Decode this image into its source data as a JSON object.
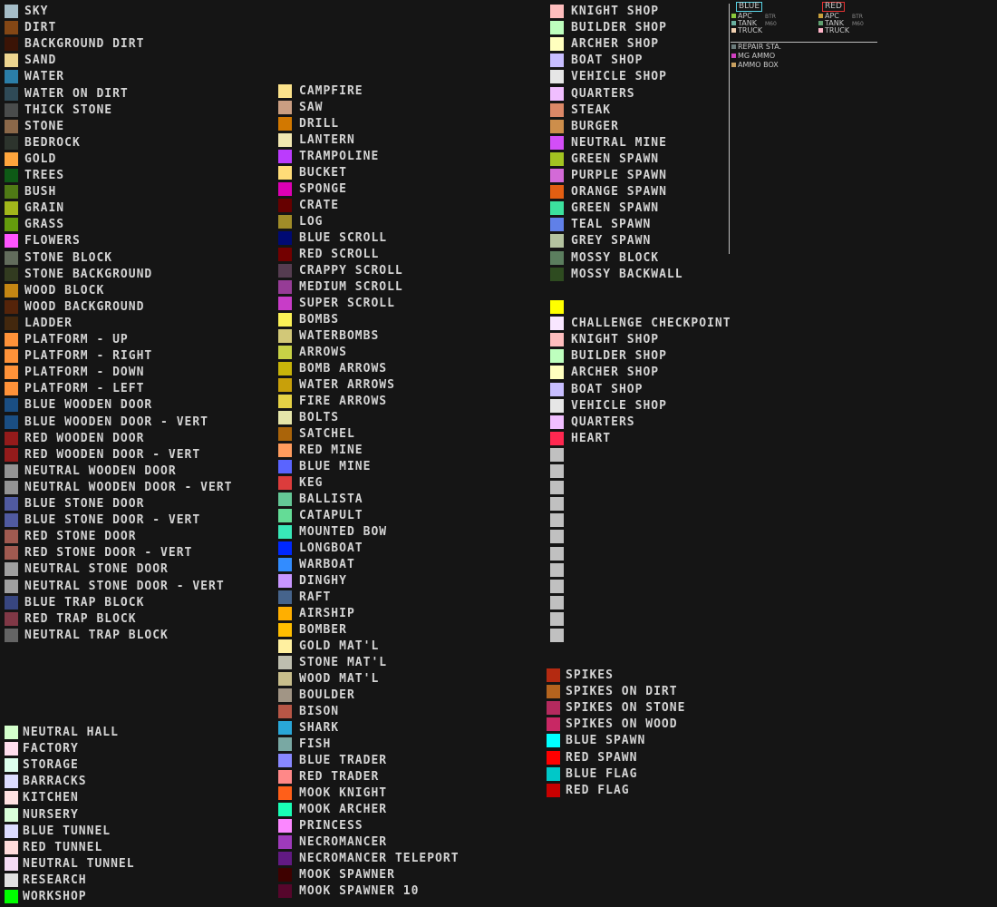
{
  "columns": [
    {
      "items": [
        {
          "label": "SKY",
          "color": "#a5bdc8"
        },
        {
          "label": "DIRT",
          "color": "#844715"
        },
        {
          "label": "BACKGROUND DIRT",
          "color": "#3b1406"
        },
        {
          "label": "SAND",
          "color": "#ecd590"
        },
        {
          "label": "WATER",
          "color": "#2b7ea8"
        },
        {
          "label": "WATER ON DIRT",
          "color": "#2f4a57"
        },
        {
          "label": "THICK STONE",
          "color": "#4a4c4c"
        },
        {
          "label": "STONE",
          "color": "#8b6849"
        },
        {
          "label": "BEDROCK",
          "color": "#2d342d"
        },
        {
          "label": "GOLD",
          "color": "#fea53d"
        },
        {
          "label": "TREES",
          "color": "#0e5a16"
        },
        {
          "label": "BUSH",
          "color": "#4f7a15"
        },
        {
          "label": "GRAIN",
          "color": "#a2b71b"
        },
        {
          "label": "GRASS",
          "color": "#649b0d"
        },
        {
          "label": "FLOWERS",
          "color": "#ff55ff"
        },
        {
          "label": "STONE BLOCK",
          "color": "#626c5c"
        },
        {
          "label": "STONE BACKGROUND",
          "color": "#323b20"
        },
        {
          "label": "WOOD BLOCK",
          "color": "#c48613"
        },
        {
          "label": "WOOD BACKGROUND",
          "color": "#55240a"
        },
        {
          "label": "LADDER",
          "color": "#43280e"
        },
        {
          "label": "PLATFORM - UP",
          "color": "#ff9239"
        },
        {
          "label": "PLATFORM - RIGHT",
          "color": "#ff9239"
        },
        {
          "label": "PLATFORM - DOWN",
          "color": "#ff9239"
        },
        {
          "label": "PLATFORM - LEFT",
          "color": "#ff9239"
        },
        {
          "label": "BLUE WOODEN DOOR",
          "color": "#1a4e83"
        },
        {
          "label": "BLUE WOODEN DOOR - VERT",
          "color": "#1a4e83"
        },
        {
          "label": "RED WOODEN DOOR",
          "color": "#941b1b"
        },
        {
          "label": "RED WOODEN DOOR - VERT",
          "color": "#941b1b"
        },
        {
          "label": "NEUTRAL WOODEN DOOR",
          "color": "#949494"
        },
        {
          "label": "NEUTRAL WOODEN DOOR - VERT",
          "color": "#949494"
        },
        {
          "label": "BLUE STONE DOOR",
          "color": "#505aa0"
        },
        {
          "label": "BLUE STONE DOOR - VERT",
          "color": "#505aa0"
        },
        {
          "label": "RED STONE DOOR",
          "color": "#a05a50"
        },
        {
          "label": "RED STONE DOOR - VERT",
          "color": "#a05a50"
        },
        {
          "label": "NEUTRAL STONE DOOR",
          "color": "#a0a0a0"
        },
        {
          "label": "NEUTRAL STONE DOOR - VERT",
          "color": "#a0a0a0"
        },
        {
          "label": "BLUE TRAP BLOCK",
          "color": "#384680"
        },
        {
          "label": "RED TRAP BLOCK",
          "color": "#803846"
        },
        {
          "label": "NEUTRAL TRAP BLOCK",
          "color": "#646464"
        }
      ]
    },
    {
      "items": [
        {
          "label": "NEUTRAL HALL",
          "color": "#d4ffcc"
        },
        {
          "label": "FACTORY",
          "color": "#ffdeee"
        },
        {
          "label": "STORAGE",
          "color": "#ddffee"
        },
        {
          "label": "BARRACKS",
          "color": "#ddddff"
        },
        {
          "label": "KITCHEN",
          "color": "#ffe2e2"
        },
        {
          "label": "NURSERY",
          "color": "#d9ffd9"
        },
        {
          "label": "BLUE TUNNEL",
          "color": "#dcdcff"
        },
        {
          "label": "RED TUNNEL",
          "color": "#ffdcdc"
        },
        {
          "label": "NEUTRAL TUNNEL",
          "color": "#f5dcf5"
        },
        {
          "label": "RESEARCH",
          "color": "#e1e1e1"
        },
        {
          "label": "WORKSHOP",
          "color": "#00ff00"
        }
      ]
    },
    {
      "items": [
        {
          "label": "CAMPFIRE",
          "color": "#fbe28b"
        },
        {
          "label": "SAW",
          "color": "#ca9e82"
        },
        {
          "label": "DRILL",
          "color": "#d27800"
        },
        {
          "label": "LANTERN",
          "color": "#f1e7b1"
        },
        {
          "label": "TRAMPOLINE",
          "color": "#bb3bfd"
        },
        {
          "label": "BUCKET",
          "color": "#ffdc78"
        },
        {
          "label": "SPONGE",
          "color": "#dc00b4"
        },
        {
          "label": "CRATE",
          "color": "#660000"
        },
        {
          "label": "LOG",
          "color": "#a08c28"
        },
        {
          "label": "BLUE SCROLL",
          "color": "#000a73"
        },
        {
          "label": "RED SCROLL",
          "color": "#730000"
        },
        {
          "label": "CRAPPY SCROLL",
          "color": "#553c50"
        },
        {
          "label": "MEDIUM SCROLL",
          "color": "#963c96"
        },
        {
          "label": "SUPER SCROLL",
          "color": "#c83cc8"
        },
        {
          "label": "BOMBS",
          "color": "#fbf157"
        },
        {
          "label": "WATERBOMBS",
          "color": "#d2c878"
        },
        {
          "label": "ARROWS",
          "color": "#c8d246"
        },
        {
          "label": "BOMB ARROWS",
          "color": "#c8b40a"
        },
        {
          "label": "WATER ARROWS",
          "color": "#c8a00a"
        },
        {
          "label": "FIRE ARROWS",
          "color": "#e6d246"
        },
        {
          "label": "BOLTS",
          "color": "#e6e6aa"
        },
        {
          "label": "SATCHEL",
          "color": "#aa640a"
        },
        {
          "label": "RED MINE",
          "color": "#ff9c5e"
        },
        {
          "label": "BLUE MINE",
          "color": "#5a64ff"
        },
        {
          "label": "KEG",
          "color": "#dc3c3c"
        },
        {
          "label": "BALLISTA",
          "color": "#64c896"
        },
        {
          "label": "CATAPULT",
          "color": "#64dc96"
        },
        {
          "label": "MOUNTED BOW",
          "color": "#38e8b8"
        },
        {
          "label": "LONGBOAT",
          "color": "#0028ff"
        },
        {
          "label": "WARBOAT",
          "color": "#328cff"
        },
        {
          "label": "DINGHY",
          "color": "#c896ff"
        },
        {
          "label": "RAFT",
          "color": "#46648c"
        },
        {
          "label": "AIRSHIP",
          "color": "#ffaf00"
        },
        {
          "label": "BOMBER",
          "color": "#ffbe00"
        },
        {
          "label": "GOLD MAT'L",
          "color": "#fff0a0"
        },
        {
          "label": "STONE MAT'L",
          "color": "#bebeaf"
        },
        {
          "label": "WOOD MAT'L",
          "color": "#c8be8c"
        },
        {
          "label": "BOULDER",
          "color": "#a19585"
        },
        {
          "label": "BISON",
          "color": "#b75646"
        },
        {
          "label": "SHARK",
          "color": "#29a7d8"
        },
        {
          "label": "FISH",
          "color": "#79a8a3"
        },
        {
          "label": "BLUE TRADER",
          "color": "#8888ff"
        },
        {
          "label": "RED TRADER",
          "color": "#ff8888"
        },
        {
          "label": "MOOK KNIGHT",
          "color": "#ff5f19"
        },
        {
          "label": "MOOK ARCHER",
          "color": "#19ffb6"
        },
        {
          "label": "PRINCESS",
          "color": "#fb87ff"
        },
        {
          "label": "NECROMANCER",
          "color": "#9e3abb"
        },
        {
          "label": "NECROMANCER TELEPORT",
          "color": "#621a83"
        },
        {
          "label": "MOOK SPAWNER",
          "color": "#3e0100"
        },
        {
          "label": "MOOK SPAWNER 10",
          "color": "#56062c"
        }
      ]
    },
    {
      "items": [
        {
          "label": "KNIGHT SHOP",
          "color": "#ffbebe"
        },
        {
          "label": "BUILDER SHOP",
          "color": "#beffbe"
        },
        {
          "label": "ARCHER SHOP",
          "color": "#ffffbe"
        },
        {
          "label": "BOAT SHOP",
          "color": "#c8beff"
        },
        {
          "label": "VEHICLE SHOP",
          "color": "#e6e6e6"
        },
        {
          "label": "QUARTERS",
          "color": "#f0beff"
        },
        {
          "label": "STEAK",
          "color": "#db8867"
        },
        {
          "label": "BURGER",
          "color": "#cd8e4b"
        },
        {
          "label": "NEUTRAL MINE",
          "color": "#d34ef7"
        },
        {
          "label": "GREEN SPAWN",
          "color": "#a2c421"
        },
        {
          "label": "PURPLE SPAWN",
          "color": "#d36ad7"
        },
        {
          "label": "ORANGE SPAWN",
          "color": "#e25e12"
        },
        {
          "label": "GREEN SPAWN",
          "color": "#3ce19e"
        },
        {
          "label": "TEAL SPAWN",
          "color": "#6080e8"
        },
        {
          "label": "GREY SPAWN",
          "color": "#b4c3a0"
        },
        {
          "label": "MOSSY BLOCK",
          "color": "#5b7e5e"
        },
        {
          "label": "MOSSY BACKWALL",
          "color": "#2e4b20"
        }
      ]
    },
    {
      "items": [
        {
          "label": "",
          "color": "#ffff00"
        },
        {
          "label": "CHALLENGE CHECKPOINT",
          "color": "#f8e6ff"
        },
        {
          "label": "KNIGHT SHOP",
          "color": "#ffbebe"
        },
        {
          "label": "BUILDER SHOP",
          "color": "#beffbe"
        },
        {
          "label": "ARCHER SHOP",
          "color": "#ffffbe"
        },
        {
          "label": "BOAT SHOP",
          "color": "#c8beff"
        },
        {
          "label": "VEHICLE SHOP",
          "color": "#e6e6e6"
        },
        {
          "label": "QUARTERS",
          "color": "#f0beff"
        },
        {
          "label": "HEART",
          "color": "#ff2850"
        },
        {
          "label": "",
          "color": "#c0c0c0"
        },
        {
          "label": "",
          "color": "#c0c0c0"
        },
        {
          "label": "",
          "color": "#c0c0c0"
        },
        {
          "label": "",
          "color": "#c0c0c0"
        },
        {
          "label": "",
          "color": "#c0c0c0"
        },
        {
          "label": "",
          "color": "#c0c0c0"
        },
        {
          "label": "",
          "color": "#c0c0c0"
        },
        {
          "label": "",
          "color": "#c0c0c0"
        },
        {
          "label": "",
          "color": "#c0c0c0"
        },
        {
          "label": "",
          "color": "#c0c0c0"
        },
        {
          "label": "",
          "color": "#c0c0c0"
        },
        {
          "label": "",
          "color": "#c0c0c0"
        }
      ]
    },
    {
      "items": [
        {
          "label": "SPIKES",
          "color": "#b42a11"
        },
        {
          "label": "SPIKES ON DIRT",
          "color": "#b4641e"
        },
        {
          "label": "SPIKES ON STONE",
          "color": "#b42a5e"
        },
        {
          "label": "SPIKES ON WOOD",
          "color": "#c82864"
        },
        {
          "label": "BLUE SPAWN",
          "color": "#00ffff"
        },
        {
          "label": "RED SPAWN",
          "color": "#ff0000"
        },
        {
          "label": "BLUE FLAG",
          "color": "#00c8c8"
        },
        {
          "label": "RED FLAG",
          "color": "#c80000"
        }
      ]
    }
  ],
  "legend": {
    "blue_title": "BLUE",
    "red_title": "RED",
    "blue_color": "#5ad4e6",
    "red_color": "#e23232",
    "blue_items": [
      {
        "label": "APC",
        "sub": "BTR",
        "color": "#8ac83c"
      },
      {
        "label": "TANK",
        "sub": "M60",
        "color": "#6ab0a0"
      },
      {
        "label": "TRUCK",
        "sub": "",
        "color": "#f0d0b0"
      }
    ],
    "red_items": [
      {
        "label": "APC",
        "sub": "BTR",
        "color": "#c8a03c"
      },
      {
        "label": "TANK",
        "sub": "M60",
        "color": "#60a070"
      },
      {
        "label": "TRUCK",
        "sub": "",
        "color": "#ffb4c8"
      }
    ],
    "misc_items": [
      {
        "label": "REPAIR STA.",
        "color": "#6a7a7a"
      },
      {
        "label": "MG AMMO",
        "color": "#d040c0"
      },
      {
        "label": "AMMO BOX",
        "color": "#c8a060"
      }
    ]
  }
}
